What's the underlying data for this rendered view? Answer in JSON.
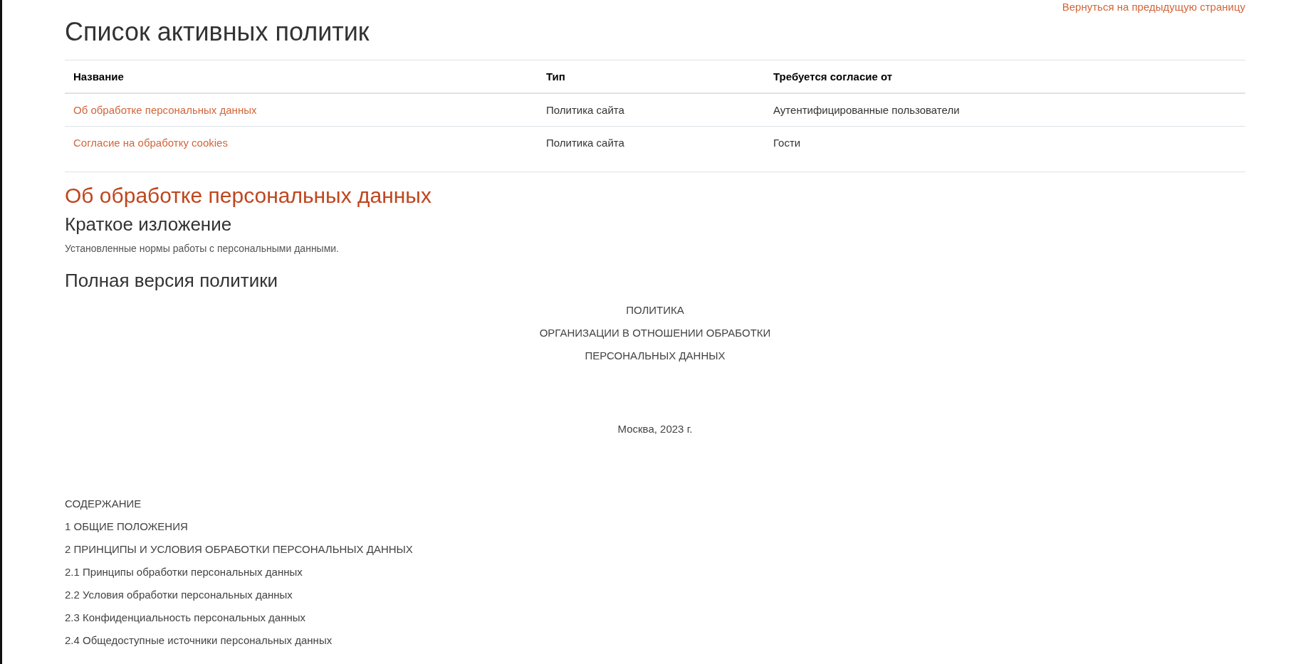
{
  "back_link": "Вернуться на предыдущую страницу",
  "title": "Список активных политик",
  "table": {
    "columns": [
      "Название",
      "Тип",
      "Требуется согласие от"
    ],
    "rows": [
      {
        "name": "Об обработке персональных данных",
        "type": "Политика сайта",
        "consent": "Аутентифицированные пользователи"
      },
      {
        "name": "Согласие на обработку cookies",
        "type": "Политика сайта",
        "consent": "Гости"
      }
    ]
  },
  "policy": {
    "title": "Об обработке персональных данных",
    "summary_heading": "Краткое изложение",
    "summary": "Установленные нормы работы с персональными данными.",
    "full_heading": "Полная версия политики",
    "title_lines": [
      "ПОЛИТИКА",
      "ОРГАНИЗАЦИИ В ОТНОШЕНИИ ОБРАБОТКИ",
      "ПЕРСОНАЛЬНЫХ ДАННЫХ"
    ],
    "date": "Москва, 2023 г.",
    "contents": [
      "СОДЕРЖАНИЕ",
      "1 ОБЩИЕ ПОЛОЖЕНИЯ",
      "2 ПРИНЦИПЫ И УСЛОВИЯ ОБРАБОТКИ ПЕРСОНАЛЬНЫХ ДАННЫХ",
      "2.1 Принципы обработки персональных данных",
      "2.2 Условия обработки персональных данных",
      "2.3 Конфиденциальность персональных данных",
      "2.4 Общедоступные источники персональных данных"
    ]
  }
}
